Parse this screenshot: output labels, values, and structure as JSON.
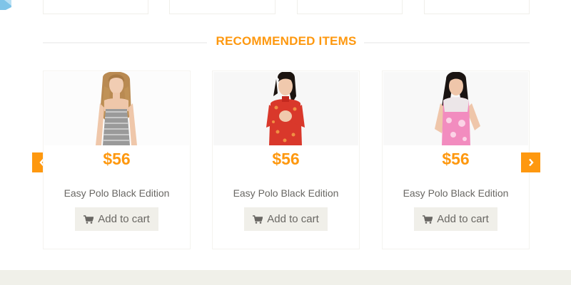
{
  "recommended": {
    "title": "RECOMMENDED ITEMS",
    "items": [
      {
        "price": "$56",
        "name": "Easy Polo Black Edition",
        "cart_label": "Add to cart"
      },
      {
        "price": "$56",
        "name": "Easy Polo Black Edition",
        "cart_label": "Add to cart"
      },
      {
        "price": "$56",
        "name": "Easy Polo Black Edition",
        "cart_label": "Add to cart"
      }
    ],
    "prev_icon": "chevron-left-icon",
    "next_icon": "chevron-right-icon"
  },
  "colors": {
    "accent": "#fe980f",
    "button_bg": "#f0efe9",
    "text": "#696763",
    "footer_bg": "#f0f0e9"
  }
}
